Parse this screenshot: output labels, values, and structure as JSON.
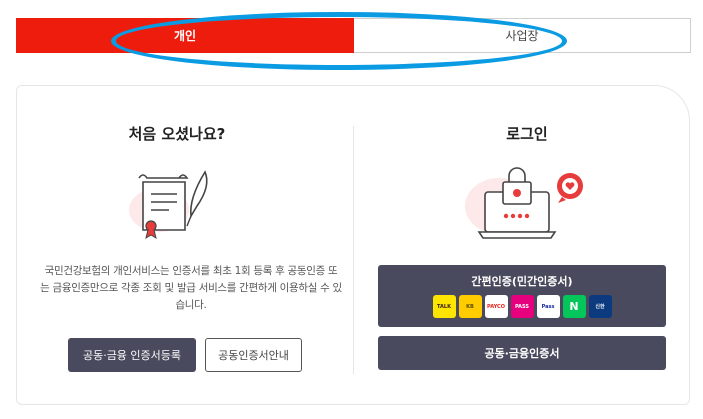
{
  "tabs": {
    "personal": "개인",
    "business": "사업장"
  },
  "signup": {
    "title": "처음 오셨나요?",
    "description": "국민건강보험의 개인서비스는 인증서를 최초 1회 등록 후 공동인증 또는 금융인증만으로 각종 조회 및 발급 서비스를 간편하게 이용하실 수 있습니다.",
    "register_button": "공동·금융 인증서등록",
    "guide_button": "공동인증서안내"
  },
  "login": {
    "title": "로그인",
    "simple_auth_label": "간편인증(민간인증서)",
    "cert_button": "공동·금융인증서",
    "providers": [
      {
        "name": "kakao",
        "label": "TALK"
      },
      {
        "name": "kb",
        "label": "KB"
      },
      {
        "name": "payco",
        "label": "PAYCO"
      },
      {
        "name": "pass",
        "label": "PASS"
      },
      {
        "name": "samsung-pass",
        "label": "Pass"
      },
      {
        "name": "naver",
        "label": "N"
      },
      {
        "name": "shinhan",
        "label": "신한"
      }
    ]
  },
  "colors": {
    "accent_red": "#ee1c0c",
    "highlight_blue": "#0a9be2",
    "button_dark": "#4a4a5e"
  }
}
